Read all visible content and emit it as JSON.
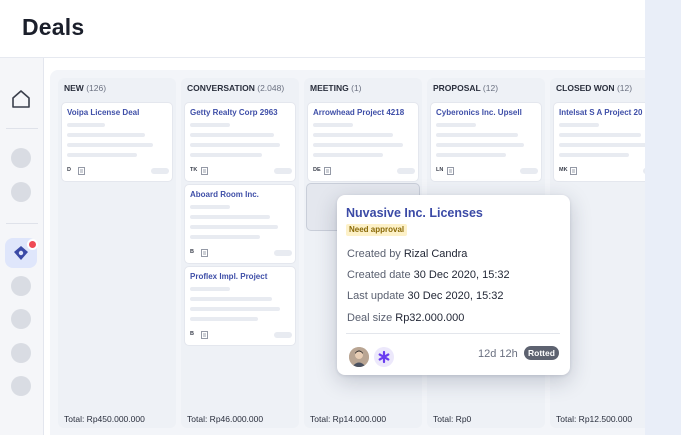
{
  "header": {
    "title": "Deals"
  },
  "columns": [
    {
      "name": "NEW",
      "count": "(126)",
      "total": "Total: Rp450.000.000",
      "cards": [
        {
          "title": "Voipa License Deal",
          "initials": "D"
        }
      ]
    },
    {
      "name": "CONVERSATION",
      "count": "(2.048)",
      "total": "Total: Rp46.000.000",
      "cards": [
        {
          "title": "Getty Realty Corp  2963",
          "initials": "TK"
        },
        {
          "title": "Aboard Room Inc.",
          "initials": "B"
        },
        {
          "title": "Proflex Impl. Project",
          "initials": "B"
        }
      ]
    },
    {
      "name": "MEETING",
      "count": "(1)",
      "total": "Total: Rp14.000.000",
      "cards": [
        {
          "title": "Arrowhead Project 4218",
          "initials": "DE"
        }
      ]
    },
    {
      "name": "PROPOSAL",
      "count": "(12)",
      "total": "Total: Rp0",
      "cards": [
        {
          "title": "Cyberonics Inc. Upsell",
          "initials": "LN"
        }
      ]
    },
    {
      "name": "CLOSED WON",
      "count": "(12)",
      "total": "Total: Rp12.500.000",
      "cards": [
        {
          "title": "Intelsat S A Project 20",
          "initials": "MK"
        }
      ]
    }
  ],
  "popover": {
    "title": "Nuvasive Inc. Licenses",
    "tag": "Need approval",
    "created_by_label": "Created by",
    "created_by_value": "Rizal Candra",
    "created_date_label": "Created date",
    "created_date_value": "30 Dec 2020, 15:32",
    "last_update_label": "Last update",
    "last_update_value": "30 Dec 2020, 15:32",
    "deal_size_label": "Deal size",
    "deal_size_value": "Rp32.000.000",
    "age": "12d 12h",
    "status": "Rotted"
  },
  "colors": {
    "accent": "#3b4aa6",
    "tag_bg": "#fdf1c8",
    "badge": "#ef4a55",
    "status_bg": "#5d6270"
  },
  "icons": [
    "home-icon",
    "deals-icon",
    "document-icon",
    "avatar",
    "star-icon"
  ]
}
